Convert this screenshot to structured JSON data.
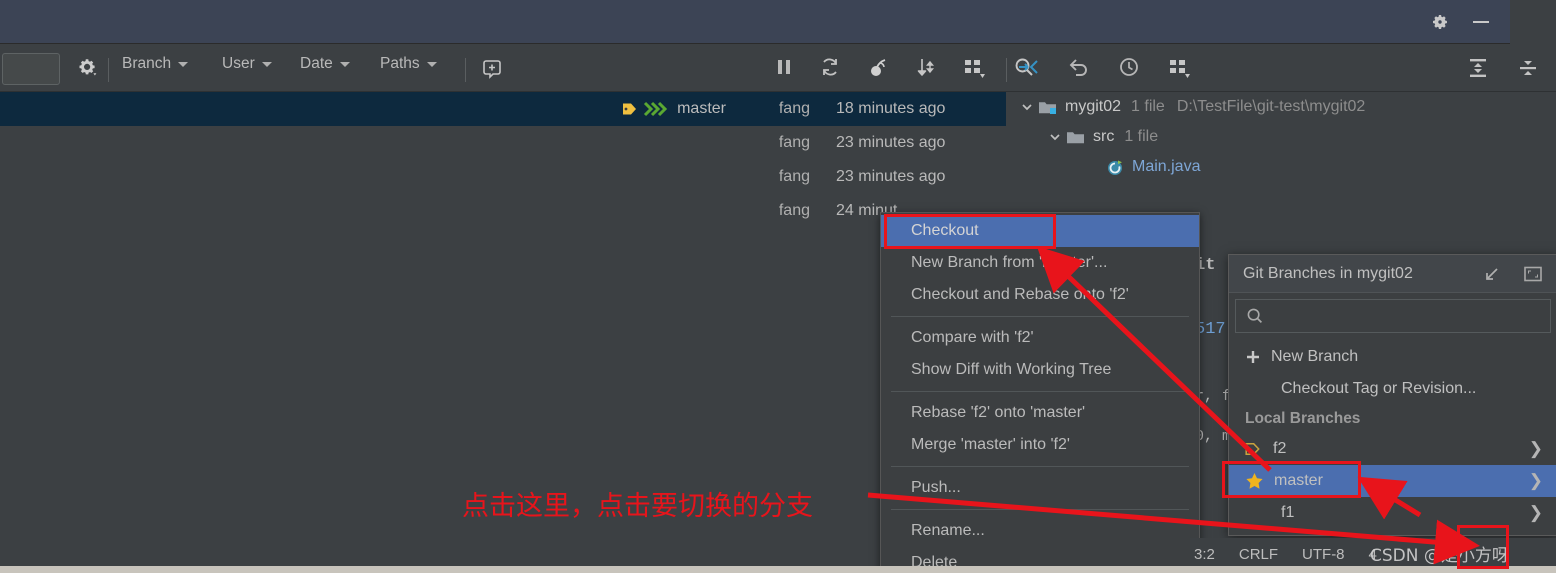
{
  "window": {
    "title_icons": [
      "gear-icon",
      "minimize-icon"
    ]
  },
  "toolbar": {
    "search_placeholder": "",
    "gear_label": "gear-icon",
    "filters": [
      {
        "label": "Branch"
      },
      {
        "label": "User"
      },
      {
        "label": "Date"
      },
      {
        "label": "Paths"
      }
    ],
    "icons_mid": [
      "pause-icon",
      "refresh-icon",
      "cherry-pick-icon",
      "sort-icon",
      "layout-icon",
      "search-icon"
    ],
    "icons_right": [
      "collapse-arrows-icon",
      "revert-icon",
      "history-clock-icon",
      "layout-icon"
    ],
    "icons_far": [
      "expand-all-icon",
      "collapse-all-icon"
    ]
  },
  "log": {
    "rows": [
      {
        "ref": "master",
        "has_label": true,
        "author": "fang",
        "date": "18 minutes ago",
        "selected": true
      },
      {
        "ref": "",
        "has_label": false,
        "author": "fang",
        "date": "23 minutes ago",
        "selected": false
      },
      {
        "ref": "",
        "has_label": false,
        "author": "fang",
        "date": "23 minutes ago",
        "selected": false
      },
      {
        "ref": "",
        "has_label": false,
        "author": "fang",
        "date": "24 minut",
        "selected": false
      }
    ]
  },
  "filetree": {
    "root": {
      "name": "mygit02",
      "count": "1 file",
      "path": "D:\\TestFile\\git-test\\mygit02"
    },
    "folder": {
      "name": "src",
      "count": "1 file"
    },
    "file": {
      "name": "Main.java"
    }
  },
  "underlying": {
    "commit_fragment": "it",
    "hash_fragment": "517",
    "frag_a": "r, f",
    "frag_b": "0, m"
  },
  "context_menu": {
    "items": [
      {
        "label": "Checkout",
        "highlighted": true,
        "separator_after": false
      },
      {
        "label": "New Branch from 'master'...",
        "highlighted": false,
        "separator_after": false
      },
      {
        "label": "Checkout and Rebase onto 'f2'",
        "highlighted": false,
        "separator_after": true
      },
      {
        "label": "Compare with 'f2'",
        "highlighted": false,
        "separator_after": false
      },
      {
        "label": "Show Diff with Working Tree",
        "highlighted": false,
        "separator_after": true
      },
      {
        "label": "Rebase 'f2' onto 'master'",
        "highlighted": false,
        "separator_after": false
      },
      {
        "label": "Merge 'master' into 'f2'",
        "highlighted": false,
        "separator_after": true
      },
      {
        "label": "Push...",
        "highlighted": false,
        "separator_after": true
      },
      {
        "label": "Rename...",
        "highlighted": false,
        "separator_after": false
      },
      {
        "label": "Delete",
        "highlighted": false,
        "separator_after": false
      }
    ]
  },
  "branch_popup": {
    "title": "Git Branches in mygit02",
    "search_value": "",
    "actions": [
      {
        "label": "New Branch",
        "icon": "plus-icon"
      },
      {
        "label": "Checkout Tag or Revision...",
        "icon": ""
      }
    ],
    "group_label": "Local Branches",
    "branches": [
      {
        "label": "f2",
        "icon": "tag-icon",
        "current": false,
        "selected": false
      },
      {
        "label": "master",
        "icon": "star-icon",
        "current": true,
        "selected": true
      },
      {
        "label": "f1",
        "icon": "",
        "current": false,
        "selected": false
      }
    ],
    "title_icons": [
      "shrink-icon",
      "restore-icon"
    ]
  },
  "status_bar": {
    "caret": "3:2",
    "line_separator": "CRLF",
    "encoding": "UTF-8",
    "trailing": "4"
  },
  "annotations": {
    "note": "点击这里，点击要切换的分支",
    "watermark": "CSDN @是小方呀",
    "accent_color": "#e8141b",
    "highlight_color": "#4b6eaf"
  }
}
